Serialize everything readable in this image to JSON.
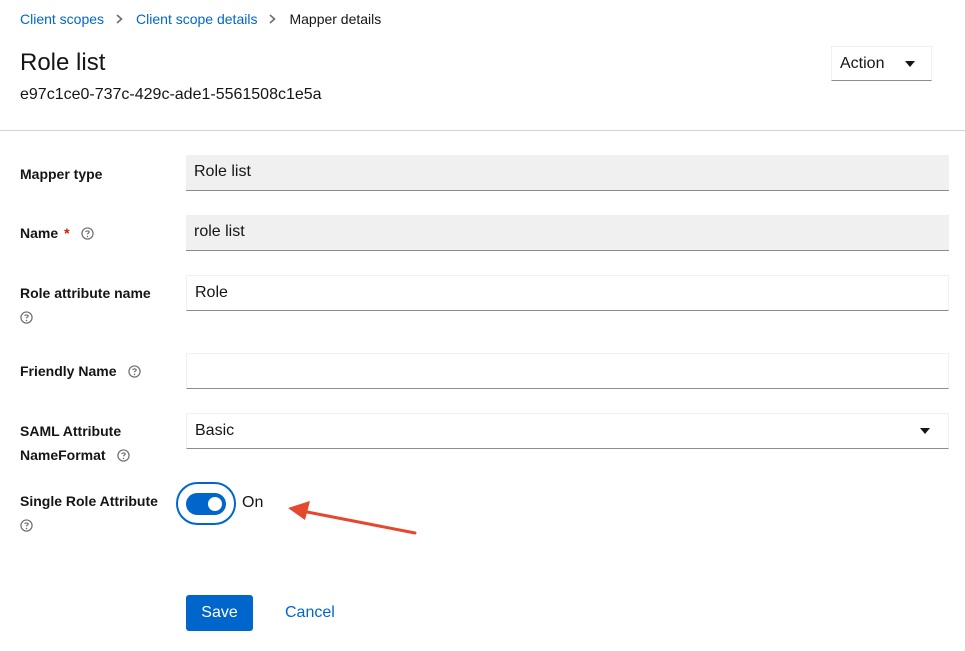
{
  "breadcrumb": {
    "items": [
      "Client scopes",
      "Client scope details"
    ],
    "current": "Mapper details"
  },
  "header": {
    "title": "Role list",
    "subtitle": "e97c1ce0-737c-429c-ade1-5561508c1e5a",
    "action_label": "Action"
  },
  "form": {
    "mapper_type": {
      "label": "Mapper type",
      "value": "Role list"
    },
    "name": {
      "label": "Name",
      "required_mark": "*",
      "value": "role list"
    },
    "role_attribute_name": {
      "label": "Role attribute name",
      "value": "Role"
    },
    "friendly_name": {
      "label": "Friendly Name",
      "value": ""
    },
    "saml_nameformat": {
      "label_line1": "SAML Attribute",
      "label_line2": "NameFormat",
      "value": "Basic"
    },
    "single_role_attribute": {
      "label": "Single Role Attribute",
      "state_label": "On",
      "on": true
    }
  },
  "actions": {
    "save_label": "Save",
    "cancel_label": "Cancel"
  },
  "colors": {
    "primary": "#0066cc",
    "required": "#c9190b",
    "annotation": "#e5482c"
  }
}
